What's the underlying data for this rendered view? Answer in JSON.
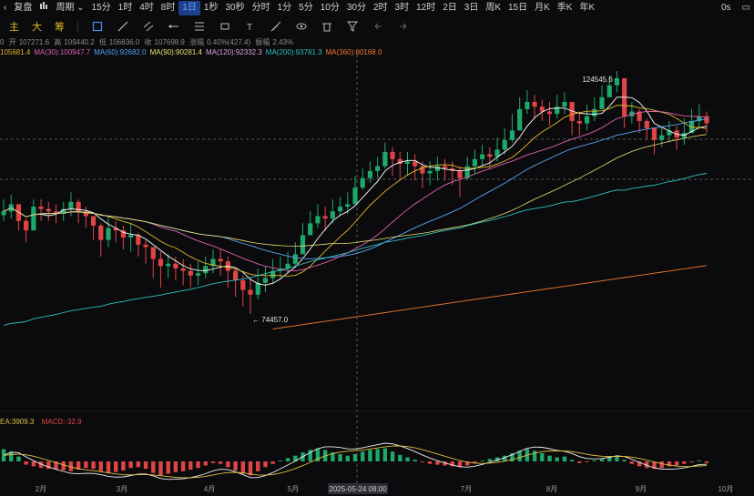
{
  "topbar": {
    "left_arrow": "‹",
    "replay": "复盘",
    "period_label": "周期",
    "periods": [
      "15分",
      "1时",
      "4时",
      "8时",
      "1日",
      "1秒",
      "30秒",
      "分时",
      "1分",
      "5分",
      "10分",
      "30分",
      "2时",
      "3时",
      "12时",
      "2日",
      "3日",
      "周K",
      "15日",
      "月K",
      "季K",
      "年K"
    ],
    "active_period": "1日",
    "right_label": "0s"
  },
  "toolbar": {
    "main_label": "主",
    "big_label": "大",
    "chip_label": "筹"
  },
  "ohlc": {
    "open_label": "开",
    "open": "107271.6",
    "high_label": "高",
    "high": "109440.2",
    "low_label": "低",
    "low": "106836.0",
    "close_label": "收",
    "close": "107698.9",
    "change_label": "涨幅",
    "change": "0.40%(427.4)",
    "amp_label": "振幅",
    "amp": "2.43%"
  },
  "ma": [
    {
      "text": "105681.4",
      "color": "#e0b92a"
    },
    {
      "text": "MA(30):100947.7",
      "color": "#e060b0"
    },
    {
      "text": "MA(60):92682.0",
      "color": "#5aa0f0"
    },
    {
      "text": "MA(90):90281.4",
      "color": "#e8e070"
    },
    {
      "text": "MA(120):92332.3",
      "color": "#e0a0e0"
    },
    {
      "text": "MA(200):93781.3",
      "color": "#2ec0c0"
    },
    {
      "text": "MA(360):80168.0",
      "color": "#f07a30"
    }
  ],
  "macd": {
    "dea": "EA:3909.3",
    "macd": "MACD:-32.9"
  },
  "chart_data": {
    "type": "candlestick",
    "x_labels": [
      "2月",
      "3月",
      "4月",
      "5月",
      "7月",
      "8月",
      "9月",
      "10月"
    ],
    "crosshair_label": "2025-05-24 08:00",
    "annotations": [
      {
        "text": "124545.6"
      },
      {
        "text": "74457.0"
      }
    ],
    "price": {
      "close": [
        96000,
        97500,
        94000,
        92000,
        97000,
        96500,
        96000,
        95500,
        96500,
        98000,
        96000,
        95000,
        93000,
        90000,
        92500,
        92000,
        90500,
        91000,
        89000,
        88500,
        86000,
        84500,
        85000,
        84000,
        83500,
        82500,
        83000,
        84500,
        86000,
        85500,
        83500,
        81500,
        79500,
        78500,
        81000,
        82000,
        83500,
        84000,
        85000,
        87000,
        91000,
        93500,
        95000,
        94500,
        96000,
        97000,
        97500,
        101000,
        103000,
        104500,
        105500,
        108500,
        107000,
        106000,
        106500,
        105500,
        104000,
        104500,
        105500,
        105000,
        104500,
        103000,
        105500,
        107000,
        108000,
        107500,
        109000,
        111000,
        113000,
        117500,
        119000,
        118000,
        117000,
        116500,
        118000,
        119000,
        115000,
        114500,
        116000,
        117500,
        120000,
        122500,
        124000,
        116000,
        117000,
        115000,
        113500,
        111000,
        112000,
        113000,
        111500,
        112500,
        115000,
        116000,
        114500
      ],
      "low": [
        94000,
        94500,
        92000,
        89500,
        94000,
        94000,
        94000,
        93500,
        94000,
        95000,
        93500,
        92500,
        90000,
        86500,
        88500,
        89500,
        88000,
        87500,
        86500,
        85000,
        82000,
        80000,
        82000,
        81500,
        80500,
        80000,
        80500,
        82000,
        83000,
        82500,
        80000,
        78000,
        76000,
        74457,
        77500,
        79000,
        81000,
        82000,
        83000,
        84500,
        87500,
        91000,
        92500,
        92000,
        93500,
        95000,
        95500,
        97500,
        100500,
        102000,
        103000,
        105000,
        103500,
        103000,
        103500,
        102500,
        101000,
        101500,
        102500,
        102500,
        101500,
        99000,
        102500,
        104000,
        105500,
        105000,
        106500,
        108000,
        110500,
        113000,
        116500,
        115500,
        115000,
        114000,
        115500,
        116500,
        112000,
        112000,
        113000,
        115000,
        117500,
        120500,
        121000,
        113500,
        114500,
        112500,
        111000,
        108000,
        109500,
        110500,
        109000,
        110000,
        112500,
        113500,
        112500
      ],
      "high": [
        98500,
        99500,
        97500,
        94500,
        98500,
        98500,
        98000,
        97500,
        98000,
        100000,
        98500,
        97000,
        95000,
        93500,
        95000,
        94000,
        93000,
        93500,
        91500,
        90000,
        88500,
        87500,
        87000,
        86500,
        86000,
        85000,
        85500,
        86500,
        88000,
        88000,
        86500,
        84000,
        82500,
        82000,
        84000,
        84500,
        86000,
        86500,
        87500,
        89500,
        93500,
        96000,
        97500,
        97000,
        98500,
        99000,
        100000,
        103500,
        105000,
        106500,
        107500,
        110500,
        109500,
        108500,
        108500,
        108000,
        106500,
        106500,
        107500,
        107000,
        106500,
        105500,
        107500,
        109000,
        110000,
        109500,
        111500,
        113500,
        116500,
        120000,
        121500,
        120500,
        119500,
        119000,
        120500,
        121000,
        118000,
        117000,
        118500,
        120000,
        122500,
        124545,
        125500,
        119000,
        119000,
        117500,
        115500,
        113500,
        114000,
        115000,
        114000,
        115500,
        117500,
        118500,
        117000
      ]
    },
    "macd": {
      "hist": [
        1500,
        1200,
        600,
        -400,
        -600,
        -800,
        -900,
        -1000,
        -1100,
        -1200,
        -1000,
        -800,
        -900,
        -1200,
        -1400,
        -1300,
        -1100,
        -800,
        -700,
        -900,
        -1400,
        -1700,
        -1500,
        -1300,
        -1200,
        -1000,
        -800,
        -500,
        -200,
        -300,
        -700,
        -1100,
        -1500,
        -1700,
        -1200,
        -700,
        -300,
        100,
        400,
        700,
        1100,
        1400,
        1600,
        1400,
        1100,
        900,
        700,
        900,
        1200,
        1400,
        1500,
        1600,
        1200,
        800,
        500,
        200,
        -100,
        -300,
        -400,
        -500,
        -600,
        -700,
        -500,
        -200,
        100,
        300,
        500,
        700,
        1000,
        1300,
        1500,
        1300,
        1000,
        700,
        500,
        600,
        200,
        -200,
        -100,
        100,
        300,
        500,
        700,
        200,
        -300,
        -600,
        -800,
        -900,
        -800,
        -600,
        -500,
        -300,
        -100,
        100,
        -200
      ]
    },
    "moving_averages": [
      "MA(30)",
      "MA(60)",
      "MA(90)",
      "MA(120)",
      "MA(200)",
      "MA(360)"
    ]
  },
  "colors": {
    "up": "#1fa86b",
    "down": "#e04545",
    "bg": "#0b0b0d",
    "active_tab": "#1c3f8a"
  }
}
